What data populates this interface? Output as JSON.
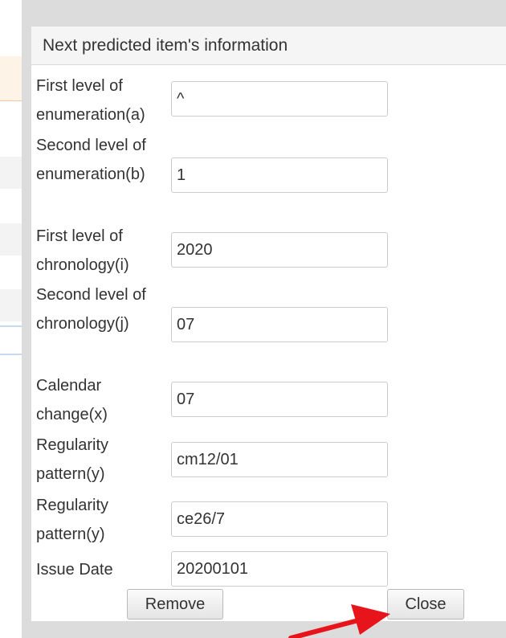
{
  "dialog": {
    "title": "Next predicted item's information",
    "fields": [
      {
        "label": "First level of enumeration(a)",
        "value": "^"
      },
      {
        "label": "Second level of enumeration(b)",
        "value": "1"
      },
      {
        "label": "First level of chronology(i)",
        "value": "2020"
      },
      {
        "label": "Second level of chronology(j)",
        "value": "07"
      },
      {
        "label": "Calendar change(x)",
        "value": "07"
      },
      {
        "label": "Regularity pattern(y)",
        "value": "cm12/01"
      },
      {
        "label": "Regularity pattern(y)",
        "value": "ce26/7"
      },
      {
        "label": "Issue Date",
        "value": "20200101"
      }
    ],
    "buttons": {
      "remove": "Remove",
      "close": "Close"
    }
  },
  "colors": {
    "arrow": "#e8141b",
    "header_bg": "#f5f5f5",
    "frame": "#dcdcdc"
  },
  "icons": [
    "red-arrow-annotation"
  ]
}
